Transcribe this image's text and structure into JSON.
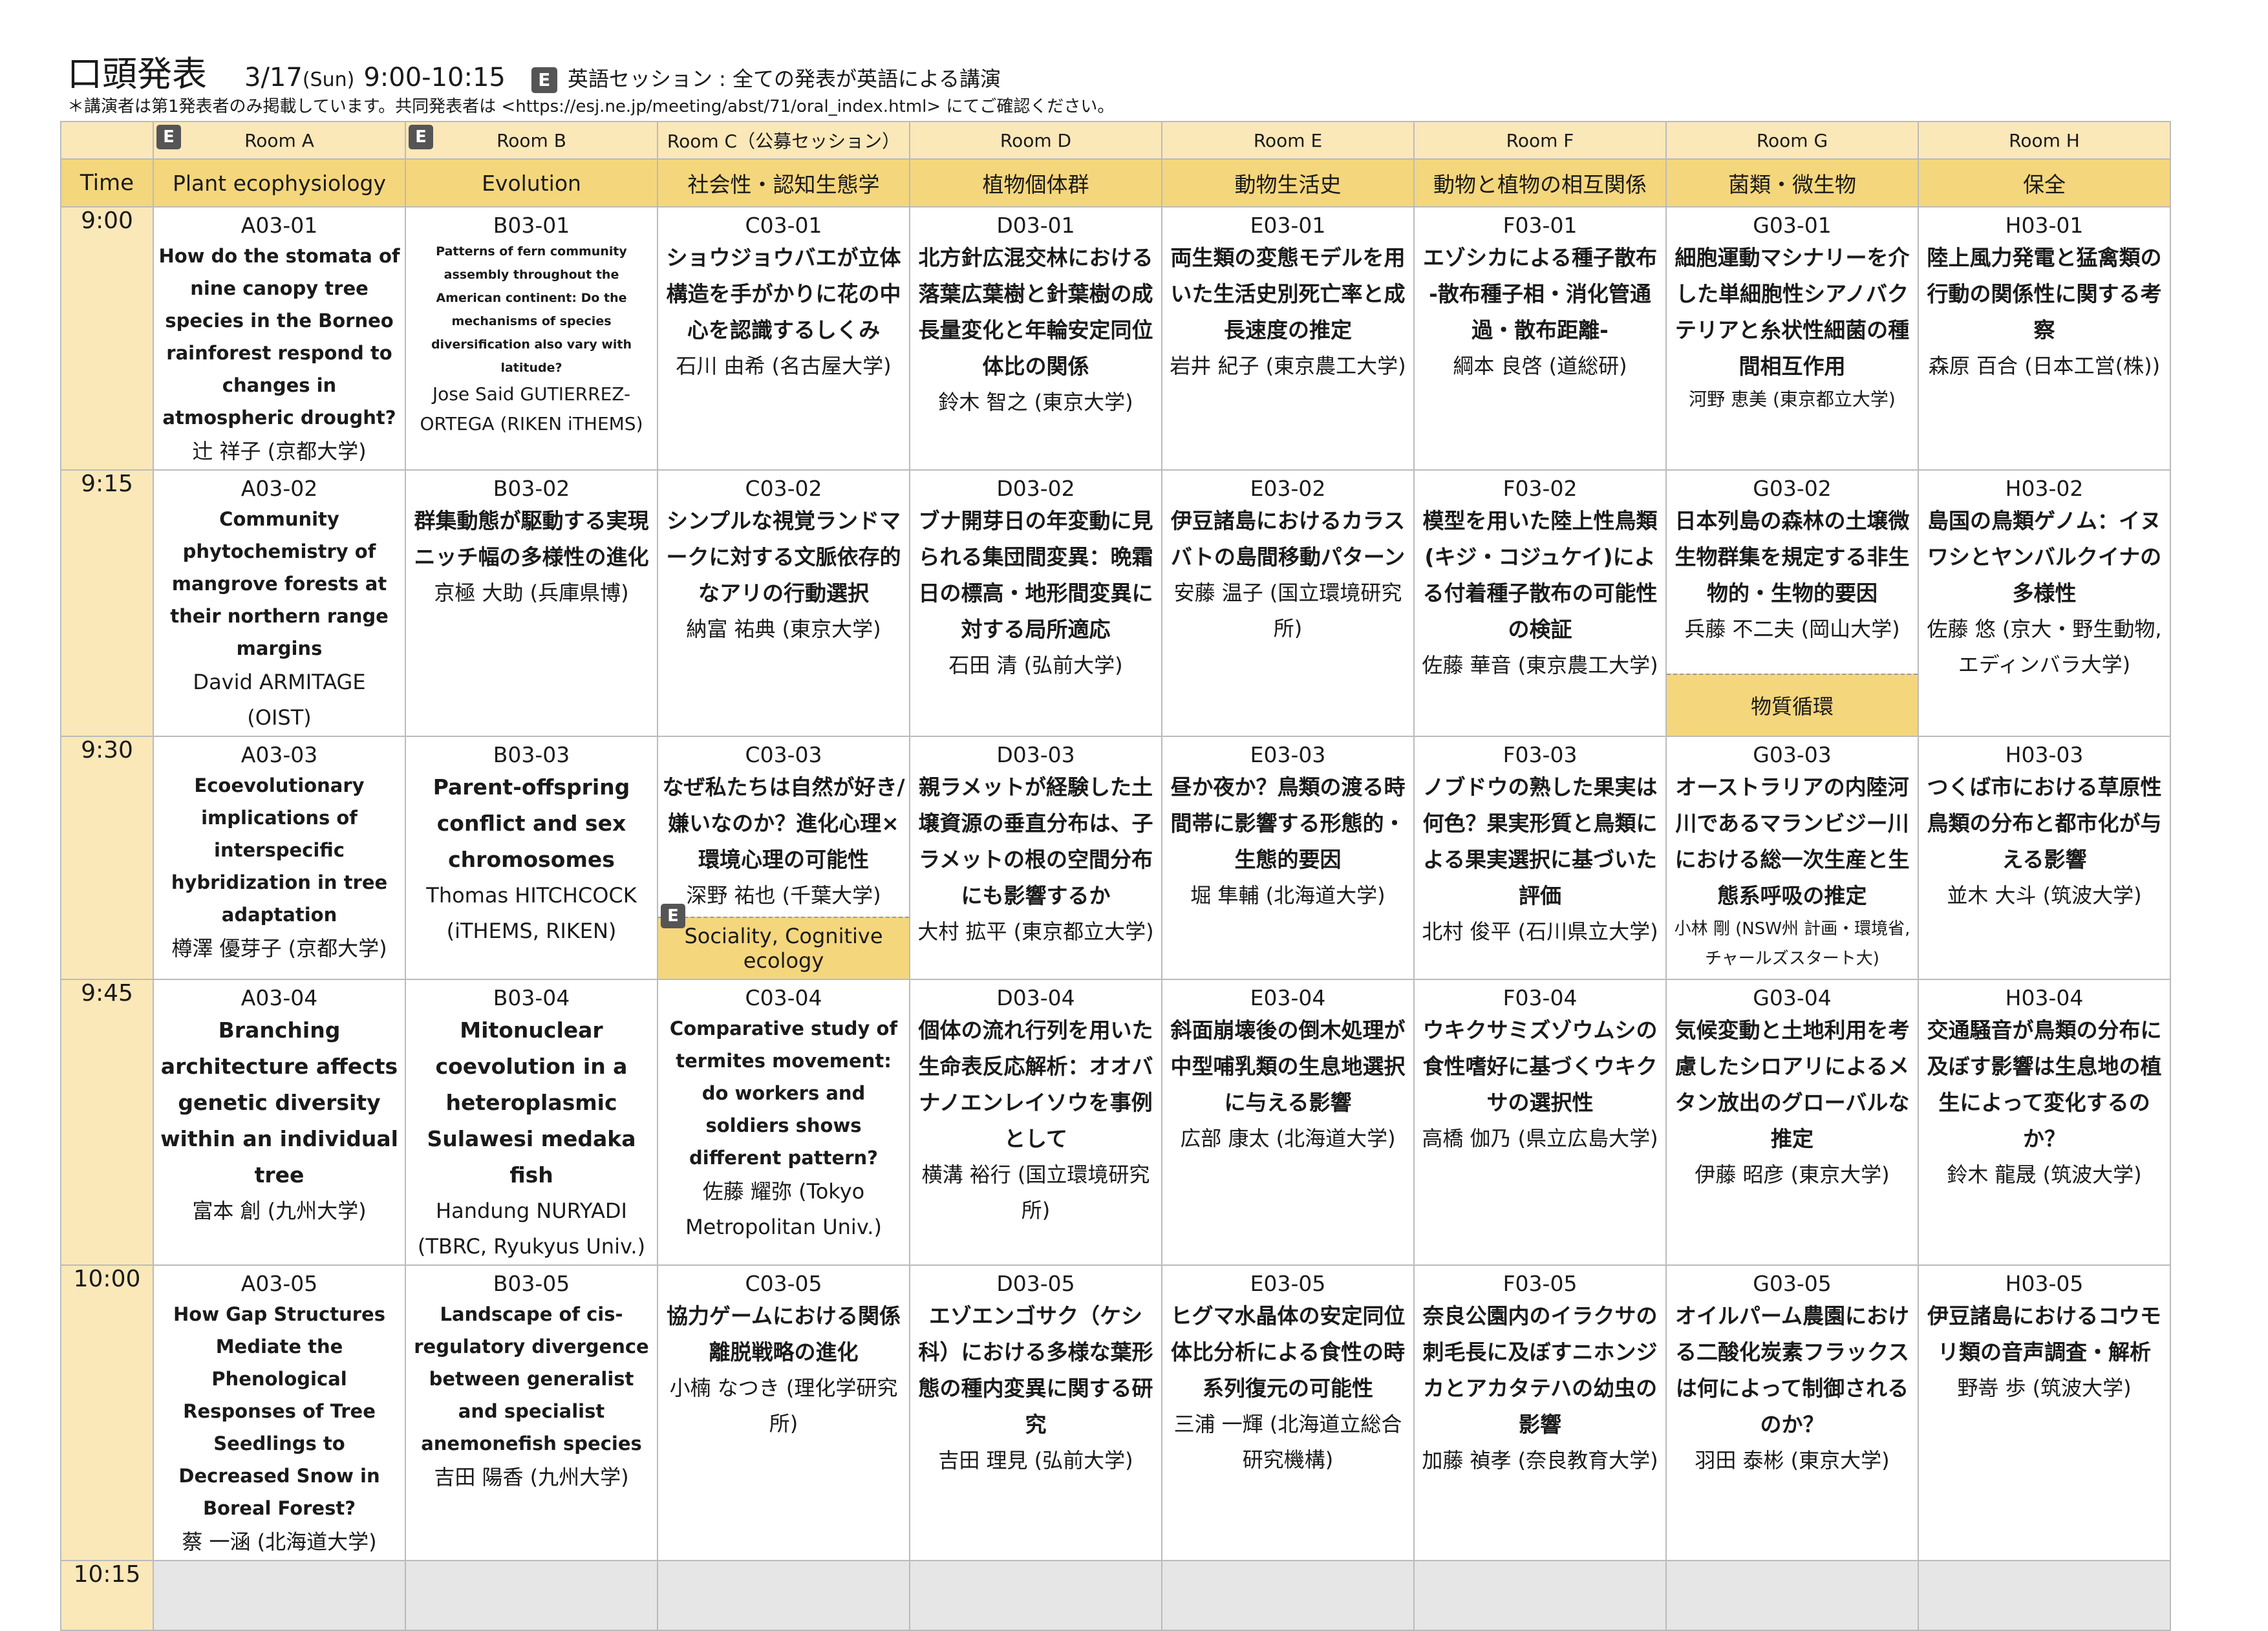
{
  "header": {
    "title": "口頭発表",
    "date": "3/17",
    "day": "(Sun)",
    "time": "9:00-10:15",
    "e_badge": "E",
    "english_note": "英語セッション : 全ての発表が英語による講演",
    "subnote": "＊講演者は第1発表者のみ掲載しています。共同発表者は <https://esj.ne.jp/meeting/abst/71/oral_index.html> にてご確認ください。"
  },
  "time_label": "Time",
  "rooms": [
    {
      "name": "Room A",
      "english": true,
      "theme": "Plant ecophysiology"
    },
    {
      "name": "Room B",
      "english": true,
      "theme": "Evolution"
    },
    {
      "name": "Room C（公募セッション）",
      "english": false,
      "theme": "社会性・認知生態学"
    },
    {
      "name": "Room D",
      "english": false,
      "theme": "植物個体群"
    },
    {
      "name": "Room E",
      "english": false,
      "theme": "動物生活史"
    },
    {
      "name": "Room F",
      "english": false,
      "theme": "動物と植物の相互関係"
    },
    {
      "name": "Room G",
      "english": false,
      "theme": "菌類・微生物"
    },
    {
      "name": "Room H",
      "english": false,
      "theme": "保全"
    }
  ],
  "times": [
    "9:00",
    "9:15",
    "9:30",
    "9:45",
    "10:00",
    "10:15"
  ],
  "subsessions": {
    "room_c": {
      "label": "Sociality, Cognitive ecology",
      "badge": "E"
    },
    "room_g": {
      "label": "物質循環"
    }
  },
  "slots": [
    [
      {
        "code": "A03-01",
        "title": "How do the stomata of nine canopy tree species in the Borneo rainforest respond to changes in atmospheric drought?",
        "speaker": "辻 祥子 (京都大学)"
      },
      {
        "code": "B03-01",
        "title": "Patterns of fern community assembly throughout the American continent: Do the mechanisms of species diversification also vary with latitude?",
        "speaker": "Jose Said GUTIERREZ-ORTEGA (RIKEN iTHEMS)"
      },
      {
        "code": "C03-01",
        "title": "ショウジョウバエが立体構造を手がかりに花の中心を認識するしくみ",
        "speaker": "石川 由希 (名古屋大学)"
      },
      {
        "code": "D03-01",
        "title": "北方針広混交林における落葉広葉樹と針葉樹の成長量変化と年輪安定同位体比の関係",
        "speaker": "鈴木 智之 (東京大学)"
      },
      {
        "code": "E03-01",
        "title": "両生類の変態モデルを用いた生活史別死亡率と成長速度の推定",
        "speaker": "岩井 紀子 (東京農工大学)"
      },
      {
        "code": "F03-01",
        "title": "エゾシカによる種子散布 -散布種子相・消化管通過・散布距離-",
        "speaker": "綱本 良啓 (道総研)"
      },
      {
        "code": "G03-01",
        "title": "細胞運動マシナリーを介した単細胞性シアノバクテリアと糸状性細菌の種間相互作用",
        "speaker": "河野 恵美 (東京都立大学)"
      },
      {
        "code": "H03-01",
        "title": "陸上風力発電と猛禽類の行動の関係性に関する考察",
        "speaker": "森原 百合 (日本工営(株))"
      }
    ],
    [
      {
        "code": "A03-02",
        "title": "Community phytochemistry of mangrove forests at their northern range margins",
        "speaker": "David ARMITAGE (OIST)"
      },
      {
        "code": "B03-02",
        "title": "群集動態が駆動する実現ニッチ幅の多様性の進化",
        "speaker": "京極 大助 (兵庫県博)"
      },
      {
        "code": "C03-02",
        "title": "シンプルな視覚ランドマークに対する文脈依存的なアリの行動選択",
        "speaker": "納富 祐典 (東京大学)"
      },
      {
        "code": "D03-02",
        "title": "ブナ開芽日の年変動に見られる集団間変異：晩霜日の標高・地形間変異に対する局所適応",
        "speaker": "石田 清 (弘前大学)"
      },
      {
        "code": "E03-02",
        "title": "伊豆諸島におけるカラスバトの島間移動パターン",
        "speaker": "安藤 温子 (国立環境研究所)"
      },
      {
        "code": "F03-02",
        "title": "模型を用いた陸上性鳥類 (キジ・コジュケイ)による付着種子散布の可能性の検証",
        "speaker": "佐藤 華音 (東京農工大学)"
      },
      {
        "code": "G03-02",
        "title": "日本列島の森林の土壌微生物群集を規定する非生物的・生物的要因",
        "speaker": "兵藤 不二夫 (岡山大学)"
      },
      {
        "code": "H03-02",
        "title": "島国の鳥類ゲノム：イヌワシとヤンバルクイナの多様性",
        "speaker": "佐藤 悠 (京大・野生動物,エディンバラ大学)"
      }
    ],
    [
      {
        "code": "A03-03",
        "title": "Ecoevolutionary implications of interspecific hybridization in tree adaptation",
        "speaker": "樽澤 優芽子 (京都大学)"
      },
      {
        "code": "B03-03",
        "title": "Parent-offspring conflict and sex chromosomes",
        "speaker": "Thomas HITCHCOCK (iTHEMS, RIKEN)"
      },
      {
        "code": "C03-03",
        "title": "なぜ私たちは自然が好き/嫌いなのか？進化心理×環境心理の可能性",
        "speaker": "深野 祐也 (千葉大学)"
      },
      {
        "code": "D03-03",
        "title": "親ラメットが経験した土壌資源の垂直分布は、子ラメットの根の空間分布にも影響するか",
        "speaker": "大村 拡平 (東京都立大学)"
      },
      {
        "code": "E03-03",
        "title": "昼か夜か？鳥類の渡る時間帯に影響する形態的・生態的要因",
        "speaker": "堀 隼輔 (北海道大学)"
      },
      {
        "code": "F03-03",
        "title": "ノブドウの熟した果実は何色？果実形質と鳥類による果実選択に基づいた評価",
        "speaker": "北村 俊平 (石川県立大学)"
      },
      {
        "code": "G03-03",
        "title": "オーストラリアの内陸河川であるマランビジー川における総一次生産と生態系呼吸の推定",
        "speaker": "小林 剛 (NSW州 計画・環境省,チャールズスタート大)"
      },
      {
        "code": "H03-03",
        "title": "つくば市における草原性鳥類の分布と都市化が与える影響",
        "speaker": "並木 大斗 (筑波大学)"
      }
    ],
    [
      {
        "code": "A03-04",
        "title": "Branching architecture affects genetic diversity within an individual tree",
        "speaker": "富本 創 (九州大学)"
      },
      {
        "code": "B03-04",
        "title": "Mitonuclear coevolution in a heteroplasmic Sulawesi medaka fish",
        "speaker": "Handung NURYADI (TBRC, Ryukyus Univ.)"
      },
      {
        "code": "C03-04",
        "title": "Comparative study of termites movement: do workers and soldiers shows different pattern?",
        "speaker": "佐藤 耀弥 (Tokyo Metropolitan Univ.)"
      },
      {
        "code": "D03-04",
        "title": "個体の流れ行列を用いた生命表反応解析：オオバナノエンレイソウを事例として",
        "speaker": "横溝 裕行 (国立環境研究所)"
      },
      {
        "code": "E03-04",
        "title": "斜面崩壊後の倒木処理が中型哺乳類の生息地選択に与える影響",
        "speaker": "広部 康太 (北海道大学)"
      },
      {
        "code": "F03-04",
        "title": "ウキクサミズゾウムシの食性嗜好に基づくウキクサの選択性",
        "speaker": "高橋 伽乃 (県立広島大学)"
      },
      {
        "code": "G03-04",
        "title": "気候変動と土地利用を考慮したシロアリによるメタン放出のグローバルな推定",
        "speaker": "伊藤 昭彦 (東京大学)"
      },
      {
        "code": "H03-04",
        "title": "交通騒音が鳥類の分布に及ぼす影響は生息地の植生によって変化するのか？",
        "speaker": "鈴木 龍晟 (筑波大学)"
      }
    ],
    [
      {
        "code": "A03-05",
        "title": "How Gap Structures Mediate the Phenological Responses of Tree Seedlings to Decreased Snow in Boreal Forest?",
        "speaker": "蔡 一涵 (北海道大学)"
      },
      {
        "code": "B03-05",
        "title": "Landscape of cis-regulatory divergence between generalist and specialist anemonefish species",
        "speaker": "吉田 陽香 (九州大学)"
      },
      {
        "code": "C03-05",
        "title": "協力ゲームにおける関係離脱戦略の進化",
        "speaker": "小楠 なつき (理化学研究所)"
      },
      {
        "code": "D03-05",
        "title": "エゾエンゴサク（ケシ科）における多様な葉形態の種内変異に関する研究",
        "speaker": "吉田 理見 (弘前大学)"
      },
      {
        "code": "E03-05",
        "title": "ヒグマ水晶体の安定同位体比分析による食性の時系列復元の可能性",
        "speaker": "三浦 一輝 (北海道立総合研究機構)"
      },
      {
        "code": "F03-05",
        "title": "奈良公園内のイラクサの刺毛長に及ぼすニホンジカとアカタテハの幼虫の影響",
        "speaker": "加藤 禎孝 (奈良教育大学)"
      },
      {
        "code": "G03-05",
        "title": "オイルパーム農園における二酸化炭素フラックスは何によって制御されるのか？",
        "speaker": "羽田 泰彬 (東京大学)"
      },
      {
        "code": "H03-05",
        "title": "伊豆諸島におけるコウモリ類の音声調査・解析",
        "speaker": "野嵜 歩 (筑波大学)"
      }
    ]
  ]
}
